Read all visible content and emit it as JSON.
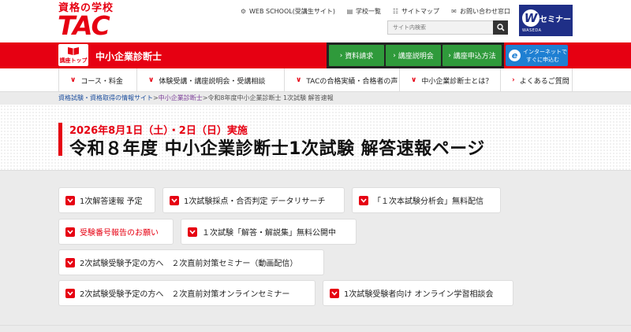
{
  "logo": {
    "tagline": "資格の学校",
    "main": "TAC"
  },
  "toplinks": [
    {
      "icon": "gear-icon",
      "glyph": "⚙",
      "label": "WEB SCHOOL(受講生サイト)"
    },
    {
      "icon": "book-icon",
      "glyph": "▤",
      "label": "学校一覧"
    },
    {
      "icon": "sitemap-icon",
      "glyph": "☷",
      "label": "サイトマップ"
    },
    {
      "icon": "mail-icon",
      "glyph": "✉",
      "label": "お問い合わせ窓口"
    }
  ],
  "search": {
    "placeholder": "サイト内検索"
  },
  "waseda": {
    "mark": "W",
    "text": "セミナー",
    "sub": "WASEDA"
  },
  "redbar": {
    "top_button": "講座トップ",
    "section_title": "中小企業診断士",
    "green_buttons": [
      "資料請求",
      "講座説明会",
      "講座申込方法"
    ],
    "net_button": {
      "line1": "インターネットで",
      "line2": "すぐに申込む"
    }
  },
  "nav": [
    "コース・料金",
    "体験受講・講座説明会・受講相談",
    "TACの合格実績・合格者の声",
    "中小企業診断士とは？",
    "よくあるご質問"
  ],
  "breadcrumb": {
    "link1": "資格試験・資格取得の情報サイト",
    "sep1": ">",
    "link2": "中小企業診断士",
    "sep2": ">",
    "current": "令和8年度中小企業診断士 1次試験 解答速報"
  },
  "hero": {
    "date": "2026年8月1日（土）・2日（日）実施",
    "title": "令和８年度 中小企業診断士1次試験 解答速報ページ"
  },
  "links": [
    "1次解答速報 予定",
    "1次試験採点・合否判定 データリサーチ",
    "「１次本試験分析会」無料配信",
    "受験番号報告のお願い",
    "１次試験「解答・解説集」無料公開中",
    "2次試験受験予定の方へ　２次直前対策セミナー（動画配信）",
    "2次試験受験予定の方へ　２次直前対策オンラインセミナー",
    "1次試験受験者向け オンライン学習相談会"
  ],
  "colors": {
    "brand_red": "#e60012",
    "green": "#2f9a3b",
    "blue": "#1e7fd2",
    "waseda_navy": "#1f2f87"
  }
}
